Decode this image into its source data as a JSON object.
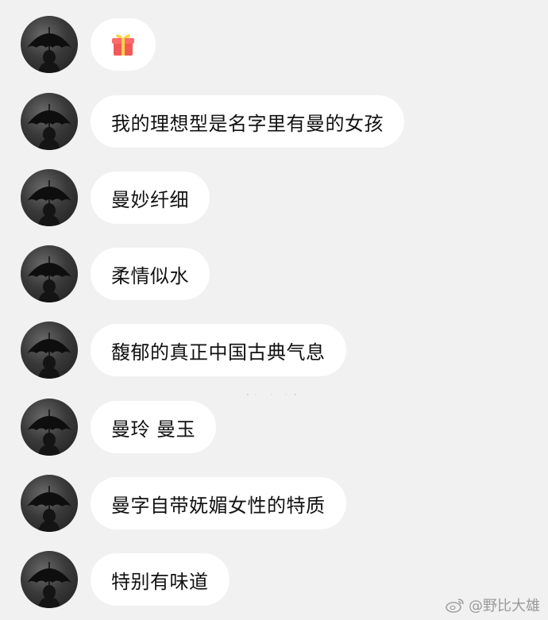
{
  "messages": [
    {
      "type": "gift",
      "icon": "gift-icon"
    },
    {
      "type": "text",
      "text": "我的理想型是名字里有曼的女孩"
    },
    {
      "type": "text",
      "text": "曼妙纤细"
    },
    {
      "type": "text",
      "text": "柔情似水"
    },
    {
      "type": "text",
      "text": "馥郁的真正中国古典气息"
    },
    {
      "type": "text",
      "text": "曼玲 曼玉"
    },
    {
      "type": "text",
      "text": "曼字自带妩媚女性的特质"
    },
    {
      "type": "text",
      "text": "特别有味道"
    }
  ],
  "watermark": {
    "icon": "weibo-icon",
    "text": "@野比大雄"
  },
  "colors": {
    "background": "#f1f1f1",
    "bubble": "#ffffff",
    "text": "#111111",
    "watermark": "#9a9a9a"
  }
}
